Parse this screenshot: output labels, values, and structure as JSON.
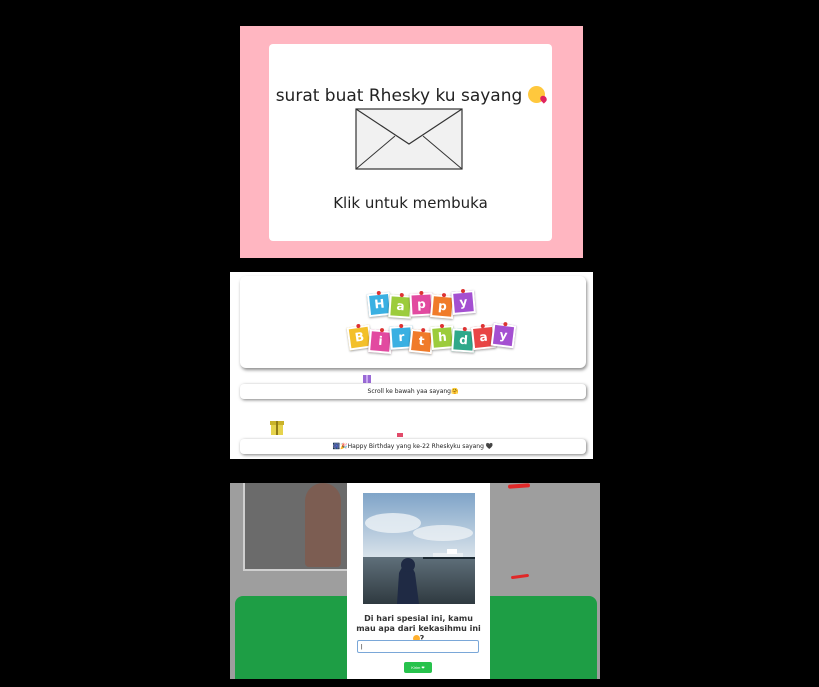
{
  "envelope_page": {
    "title": "surat buat Rhesky ku sayang",
    "title_emoji": "face-blowing-kiss-emoji",
    "open_label": "Klik untuk membuka",
    "background_color": "#ffb6c1"
  },
  "birthday_page": {
    "banner_word_1": "Happy",
    "banner_word_2": "Birthday",
    "scroll_hint": "Scroll ke bawah yaa sayang🤗",
    "greeting": "🎆🎉Happy Birthday yang ke-22 Rheskyku sayang 🖤"
  },
  "question_page": {
    "question": "Di hari spesial ini, kamu mau apa dari kekasihmu ini",
    "question_suffix": "?",
    "answer_value": "|",
    "submit_label": "Kirim ❤",
    "accent_green": "#1e9e45"
  }
}
